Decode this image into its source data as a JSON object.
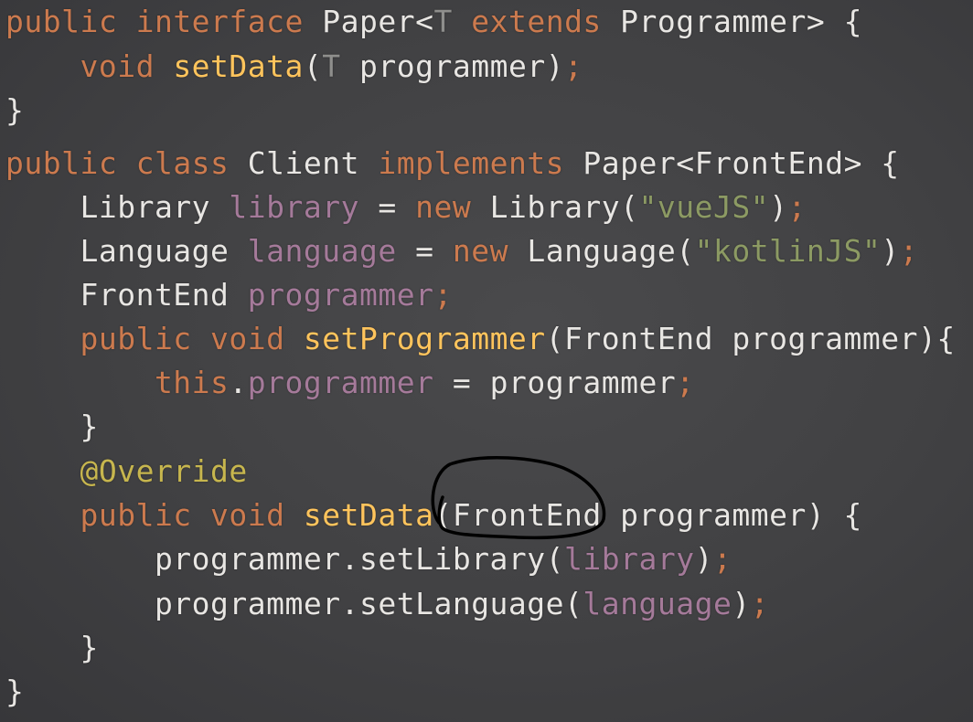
{
  "code": {
    "lines": [
      [
        {
          "t": "public ",
          "c": "kw"
        },
        {
          "t": "interface ",
          "c": "kw"
        },
        {
          "t": "Paper<",
          "c": "plain"
        },
        {
          "t": "T",
          "c": "tp"
        },
        {
          "t": " extends ",
          "c": "kw"
        },
        {
          "t": "Programmer> {",
          "c": "plain"
        }
      ],
      [
        {
          "t": "    void ",
          "c": "kw"
        },
        {
          "t": "setData",
          "c": "fn"
        },
        {
          "t": "(",
          "c": "pun"
        },
        {
          "t": "T",
          "c": "tp"
        },
        {
          "t": " programmer)",
          "c": "plain"
        },
        {
          "t": ";",
          "c": "semi"
        }
      ],
      [
        {
          "t": "}",
          "c": "plain"
        }
      ],
      [
        {
          "t": "public ",
          "c": "kw"
        },
        {
          "t": "class ",
          "c": "kw"
        },
        {
          "t": "Client ",
          "c": "plain"
        },
        {
          "t": "implements ",
          "c": "kw"
        },
        {
          "t": "Paper<FrontEnd> {",
          "c": "plain"
        }
      ],
      [
        {
          "t": "    Library ",
          "c": "plain"
        },
        {
          "t": "library",
          "c": "fld"
        },
        {
          "t": " = ",
          "c": "plain"
        },
        {
          "t": "new ",
          "c": "kw"
        },
        {
          "t": "Library(",
          "c": "plain"
        },
        {
          "t": "\"vueJS\"",
          "c": "str"
        },
        {
          "t": ")",
          "c": "plain"
        },
        {
          "t": ";",
          "c": "semi"
        }
      ],
      [
        {
          "t": "    Language ",
          "c": "plain"
        },
        {
          "t": "language",
          "c": "fld"
        },
        {
          "t": " = ",
          "c": "plain"
        },
        {
          "t": "new ",
          "c": "kw"
        },
        {
          "t": "Language(",
          "c": "plain"
        },
        {
          "t": "\"kotlinJS\"",
          "c": "str"
        },
        {
          "t": ")",
          "c": "plain"
        },
        {
          "t": ";",
          "c": "semi"
        }
      ],
      [
        {
          "t": "    FrontEnd ",
          "c": "plain"
        },
        {
          "t": "programmer",
          "c": "fld"
        },
        {
          "t": ";",
          "c": "semi"
        }
      ],
      [
        {
          "t": "    public ",
          "c": "kw"
        },
        {
          "t": "void ",
          "c": "kw"
        },
        {
          "t": "setProgrammer",
          "c": "fn"
        },
        {
          "t": "(FrontEnd programmer){",
          "c": "plain"
        }
      ],
      [
        {
          "t": "        this",
          "c": "kw"
        },
        {
          "t": ".",
          "c": "plain"
        },
        {
          "t": "programmer",
          "c": "fld"
        },
        {
          "t": " = programmer",
          "c": "plain"
        },
        {
          "t": ";",
          "c": "semi"
        }
      ],
      [
        {
          "t": "    }",
          "c": "plain"
        }
      ],
      [
        {
          "t": "    @Override",
          "c": "ann"
        }
      ],
      [
        {
          "t": "    public ",
          "c": "kw"
        },
        {
          "t": "void ",
          "c": "kw"
        },
        {
          "t": "setData",
          "c": "fn"
        },
        {
          "t": "(FrontEnd programmer) {",
          "c": "plain"
        }
      ],
      [
        {
          "t": "        programmer.setLibrary(",
          "c": "plain"
        },
        {
          "t": "library",
          "c": "fld"
        },
        {
          "t": ")",
          "c": "plain"
        },
        {
          "t": ";",
          "c": "semi"
        }
      ],
      [
        {
          "t": "        programmer.setLanguage(",
          "c": "plain"
        },
        {
          "t": "language",
          "c": "fld"
        },
        {
          "t": ")",
          "c": "plain"
        },
        {
          "t": ";",
          "c": "semi"
        }
      ],
      [
        {
          "t": "    }",
          "c": "plain"
        }
      ],
      [
        {
          "t": "}",
          "c": "plain"
        }
      ]
    ],
    "colors": {
      "background": "#444446",
      "keyword": "#cc7a4e",
      "type_param": "#8e8e8c",
      "method": "#ffc45c",
      "plain": "#e8e6e3",
      "field": "#a57a9a",
      "string": "#8c9a63",
      "annotation": "#c7b64e"
    }
  },
  "annotation_mark": {
    "kind": "hand-drawn circle",
    "circled_text": "FrontEnd",
    "color": "#000000"
  }
}
